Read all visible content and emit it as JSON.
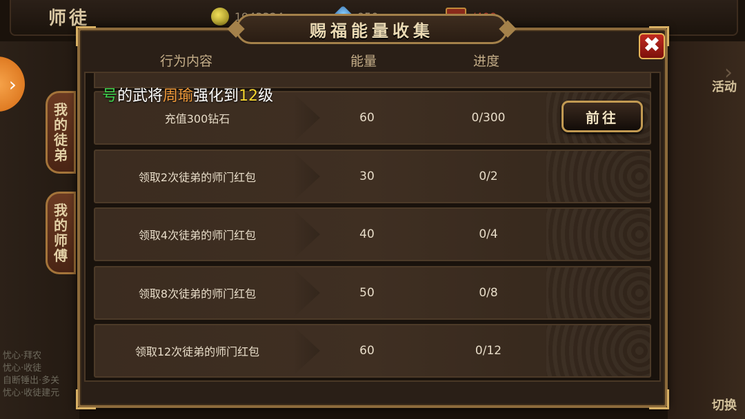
{
  "background": {
    "title": "师徒",
    "currency_gold": "1943324",
    "currency_gem": "950",
    "energy": "/400",
    "side_tab_disciple": [
      "我",
      "的",
      "徒",
      "弟"
    ],
    "side_tab_master": [
      "我",
      "的",
      "师",
      "傅"
    ],
    "right_label_top": "活动",
    "right_label_bottom": "切换",
    "chat_lines": [
      "忧心·拜农",
      "忧心·收徒",
      "自断锤出·多关",
      "忧心·收徒建元"
    ]
  },
  "dialog": {
    "title": "赐福能量收集",
    "close_symbol": "✖",
    "headers": {
      "action": "行为内容",
      "energy": "能量",
      "progress": "进度"
    },
    "notice": {
      "part1": "号",
      "part2": "的武将",
      "part3": "周瑜",
      "part4": "强化到",
      "part5": "12",
      "part6": "级"
    },
    "rows": [
      {
        "action": "充值300钻石",
        "energy": "60",
        "progress": "0/300",
        "button": "前往"
      },
      {
        "action": "领取2次徒弟的师门红包",
        "energy": "30",
        "progress": "0/2"
      },
      {
        "action": "领取4次徒弟的师门红包",
        "energy": "40",
        "progress": "0/4"
      },
      {
        "action": "领取8次徒弟的师门红包",
        "energy": "50",
        "progress": "0/8"
      },
      {
        "action": "领取12次徒弟的师门红包",
        "energy": "60",
        "progress": "0/12"
      }
    ]
  },
  "colors": {
    "accent_gold": "#c29a52",
    "close_red": "#c12a20",
    "text_green": "#3fd24d",
    "text_orange": "#f09a3a",
    "text_yellow": "#f5d430"
  },
  "icons": {
    "gold": "coin-icon",
    "gem": "gem-icon",
    "energy": "chest-icon",
    "close": "close-icon",
    "arrow": "chevron-right-icon"
  }
}
